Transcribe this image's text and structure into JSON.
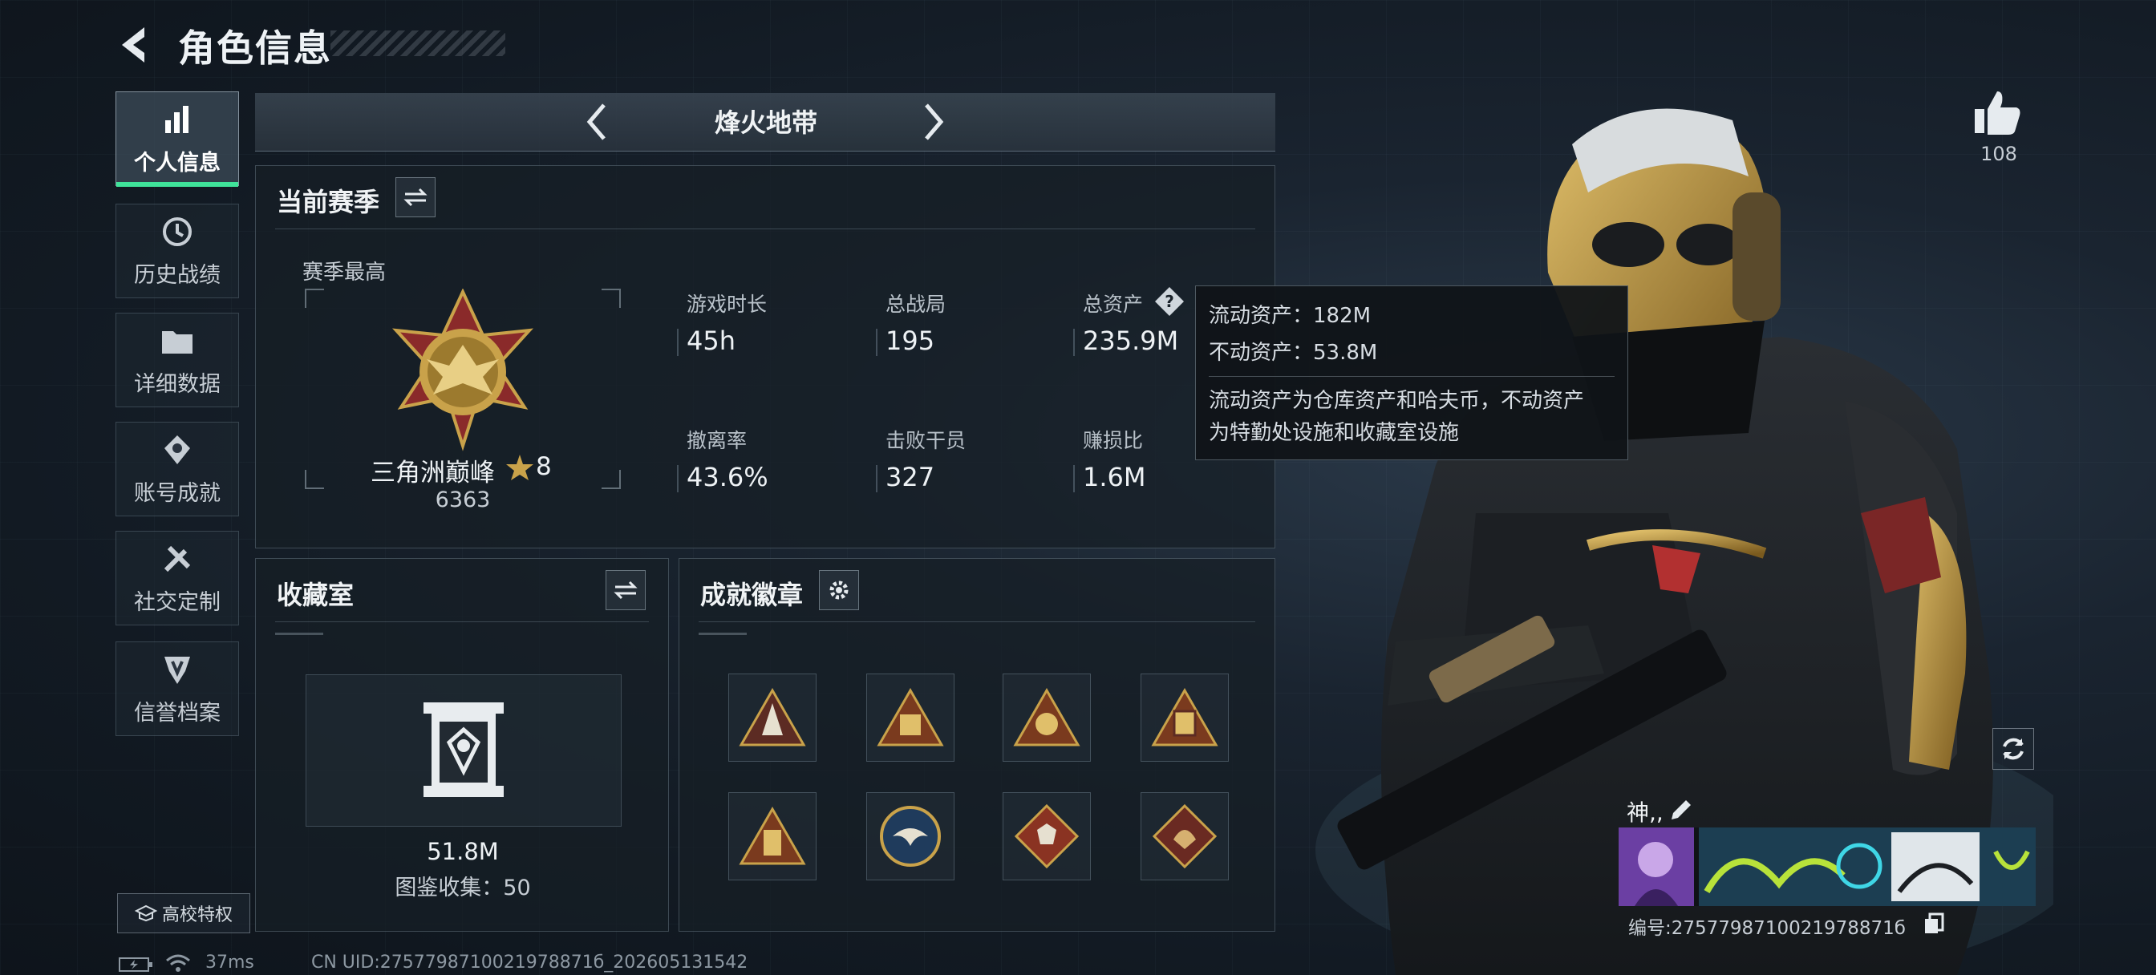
{
  "header": {
    "title": "角色信息",
    "back_icon": "back-arrow-icon"
  },
  "sidebar": {
    "items": [
      {
        "label": "个人信息",
        "icon": "bar-chart-icon",
        "active": true
      },
      {
        "label": "历史战绩",
        "icon": "history-clock-icon",
        "active": false
      },
      {
        "label": "详细数据",
        "icon": "folder-icon",
        "active": false
      },
      {
        "label": "账号成就",
        "icon": "achievement-medal-icon",
        "active": false
      },
      {
        "label": "社交定制",
        "icon": "tools-icon",
        "active": false
      },
      {
        "label": "信誉档案",
        "icon": "shield-emblem-icon",
        "active": false
      }
    ],
    "campus_button": "高校特权"
  },
  "mode": {
    "label": "烽火地带"
  },
  "season": {
    "title": "当前赛季",
    "highest_label": "赛季最高",
    "rank_name": "三角洲巅峰",
    "rank_star": "8",
    "rank_score": "6363",
    "stats": [
      {
        "label": "游戏时长",
        "value": "45h"
      },
      {
        "label": "总战局",
        "value": "195"
      },
      {
        "label": "总资产",
        "value": "235.9M"
      },
      {
        "label": "撤离率",
        "value": "43.6%"
      },
      {
        "label": "击败干员",
        "value": "327"
      },
      {
        "label": "赚损比",
        "value": "1.6M"
      }
    ]
  },
  "tooltip": {
    "liquid": "流动资产：182M",
    "fixed": "不动资产：53.8M",
    "desc_line1": "流动资产为仓库资产和哈夫币，不动资产",
    "desc_line2": "为特勤处设施和收藏室设施"
  },
  "collection": {
    "title": "收藏室",
    "value": "51.8M",
    "caption": "图鉴收集：50"
  },
  "achievements": {
    "title": "成就徽章"
  },
  "profile": {
    "likes": "108",
    "name": "神,,",
    "id_text": "编号:2757798710021978871б",
    "uid_text": "CN UID:2757798710021978871б_202605131542"
  },
  "status_bar": {
    "ping": "37ms"
  },
  "colors": {
    "accent_green": "#3fe39a",
    "gold": "#c9a24a",
    "bg": "#121a23"
  }
}
